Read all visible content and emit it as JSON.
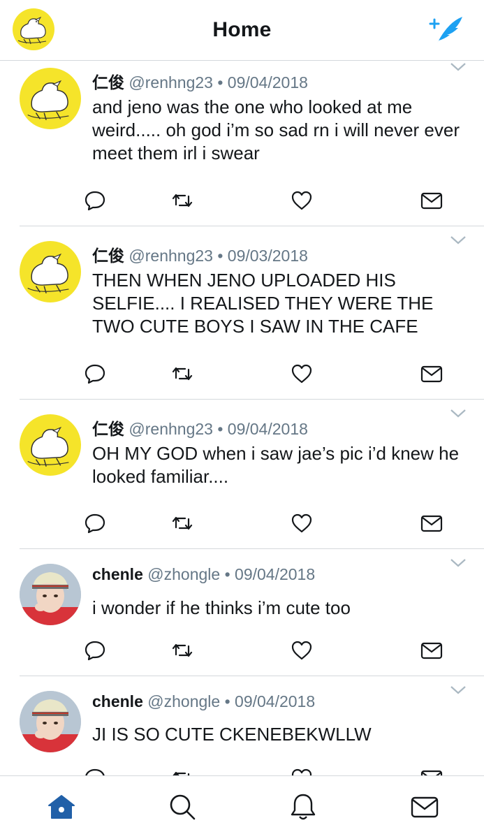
{
  "header": {
    "title": "Home",
    "avatar_icon": "profile-duck-avatar",
    "compose_icon": "compose-tweet-icon"
  },
  "tweets": [
    {
      "name": "仁俊",
      "handle": "@renhng23",
      "separator": "•",
      "date": "09/04/2018",
      "text": "and jeno was the one who looked at me weird..... oh god i’m so sad rn i will never ever meet them irl i swear",
      "avatar": "duck"
    },
    {
      "name": "仁俊",
      "handle": "@renhng23",
      "separator": "•",
      "date": "09/03/2018",
      "text": "THEN WHEN JENO UPLOADED HIS SELFIE.... I REALISED THEY WERE THE TWO CUTE BOYS I SAW IN THE CAFE",
      "avatar": "duck"
    },
    {
      "name": "仁俊",
      "handle": "@renhng23",
      "separator": "•",
      "date": "09/04/2018",
      "text": "OH MY GOD when i saw jae’s pic i’d knew he looked familiar....",
      "avatar": "duck"
    },
    {
      "name": "chenle",
      "handle": "@zhongle",
      "separator": "•",
      "date": "09/04/2018",
      "text": "i wonder if he thinks i’m cute too",
      "avatar": "person"
    },
    {
      "name": "chenle",
      "handle": "@zhongle",
      "separator": "•",
      "date": "09/04/2018",
      "text": "JI IS SO CUTE CKENEBEKWLLW",
      "avatar": "person"
    }
  ],
  "action_icons": [
    "reply-icon",
    "retweet-icon",
    "like-icon",
    "direct-message-icon"
  ],
  "tabs": [
    "home-icon",
    "search-icon",
    "notifications-icon",
    "messages-icon"
  ],
  "colors": {
    "accent": "#1da1f2",
    "active_tab": "#2160a8",
    "muted": "#657786",
    "icon": "#657786",
    "border": "#d4d8dc"
  }
}
